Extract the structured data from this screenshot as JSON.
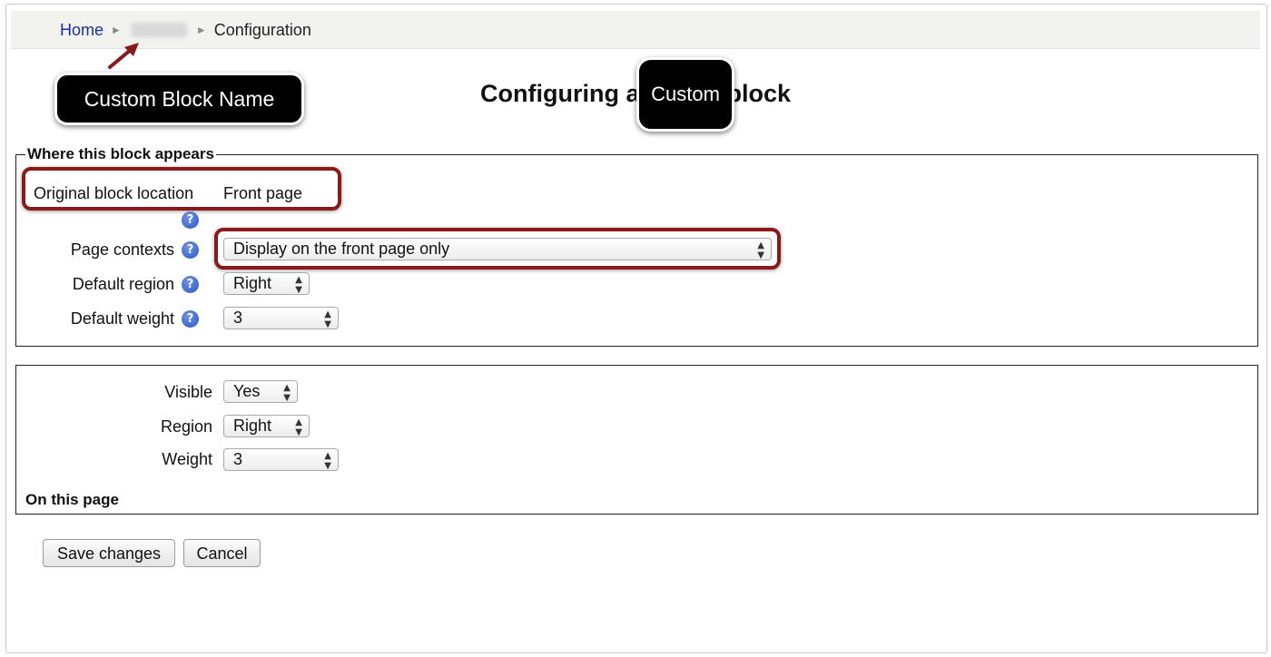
{
  "breadcrumb": {
    "home": "Home",
    "separator": "►",
    "current": "Configuration"
  },
  "annotations": {
    "block_name_callout": "Custom Block Name",
    "custom_callout": "Custom"
  },
  "page_title": {
    "prefix": "Configuring a",
    "suffix": "block"
  },
  "where_section": {
    "legend": "Where this block appears",
    "original_location_label": "Original block location",
    "original_location_value": "Front page",
    "page_contexts_label": "Page contexts",
    "page_contexts_value": "Display on the front page only",
    "default_region_label": "Default region",
    "default_region_value": "Right",
    "default_weight_label": "Default weight",
    "default_weight_value": "3"
  },
  "on_this_page": {
    "heading": "On this page",
    "visible_label": "Visible",
    "visible_value": "Yes",
    "region_label": "Region",
    "region_value": "Right",
    "weight_label": "Weight",
    "weight_value": "3"
  },
  "buttons": {
    "save": "Save changes",
    "cancel": "Cancel"
  },
  "colors": {
    "link": "#1a2fa0",
    "highlight": "#8a1a1a",
    "help_icon": "#2a56c4",
    "callout_bg": "#000000"
  },
  "icons": {
    "help": "question-mark-icon",
    "select_caret": "updown-caret-icon",
    "annotation_arrow": "arrow-icon"
  }
}
